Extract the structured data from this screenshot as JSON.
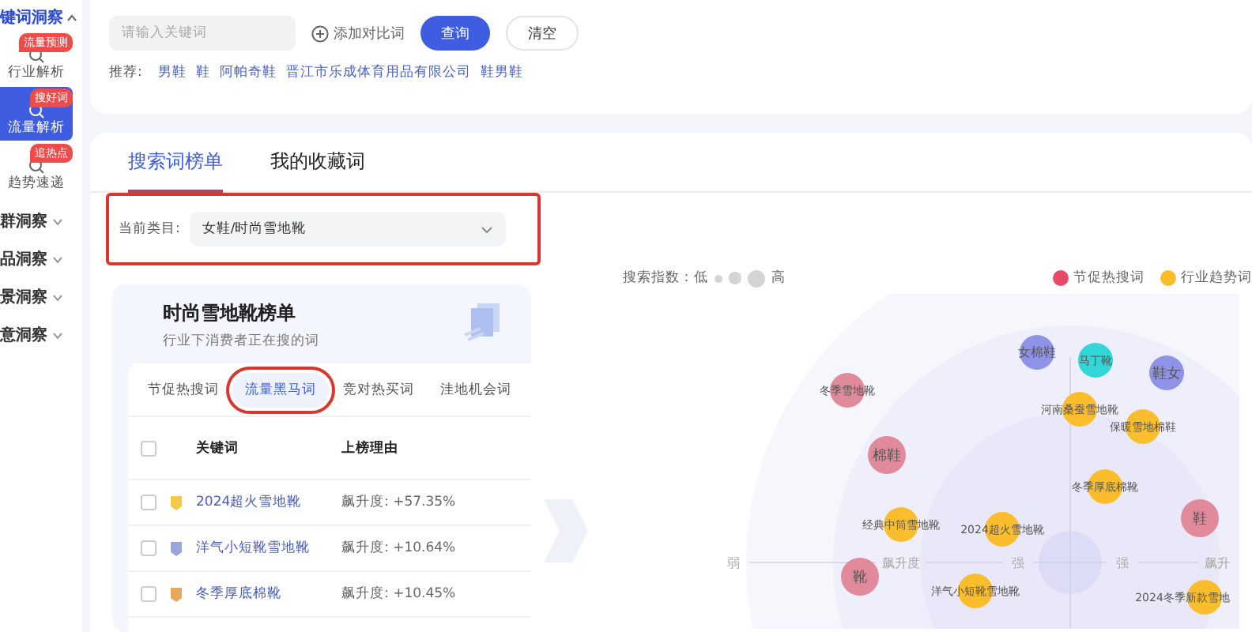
{
  "sidebar": {
    "group_title": "键词洞察",
    "items": [
      {
        "label": "行业解析",
        "badge": "流量预测",
        "selected": false
      },
      {
        "label": "流量解析",
        "badge": "搜好词",
        "selected": true
      },
      {
        "label": "趋势速递",
        "badge": "追热点",
        "selected": false
      }
    ],
    "groups": [
      {
        "label": "群洞察",
        "expanded": false
      },
      {
        "label": "品洞察",
        "expanded": false
      },
      {
        "label": "景洞察",
        "expanded": false
      },
      {
        "label": "意洞察",
        "expanded": false
      }
    ]
  },
  "search": {
    "placeholder": "请输入关键词",
    "add_compare": "添加对比词",
    "query_button": "查询",
    "clear_button": "清空",
    "recommend_label": "推荐:",
    "recommendations": [
      "男鞋",
      "鞋",
      "阿帕奇鞋",
      "晋江市乐成体育用品有限公司",
      "鞋男鞋"
    ]
  },
  "tabs": [
    {
      "label": "搜索词榜单",
      "selected": true
    },
    {
      "label": "我的收藏词",
      "selected": false
    }
  ],
  "category": {
    "label": "当前类目:",
    "value": "女鞋/时尚雪地靴",
    "highlighted": true
  },
  "ranking": {
    "title": "时尚雪地靴榜单",
    "subtitle": "行业下消费者正在搜的词",
    "subtabs": [
      {
        "label": "节促热搜词",
        "selected": false,
        "highlighted": false
      },
      {
        "label": "流量黑马词",
        "selected": true,
        "highlighted": true
      },
      {
        "label": "竞对热买词",
        "selected": false,
        "highlighted": false
      },
      {
        "label": "洼地机会词",
        "selected": false,
        "highlighted": false
      }
    ],
    "columns": [
      "关键词",
      "上榜理由"
    ],
    "header_checked": false,
    "rows": [
      {
        "checked": false,
        "color": "#f2c94c",
        "keyword": "2024超火雪地靴",
        "reason": "飙升度: +57.35%"
      },
      {
        "checked": false,
        "color": "#9aa6d8",
        "keyword": "洋气小短靴雪地靴",
        "reason": "飙升度: +10.64%"
      },
      {
        "checked": false,
        "color": "#e6a85c",
        "keyword": "冬季厚底棉靴",
        "reason": "飙升度: +10.45%"
      }
    ]
  },
  "chart": {
    "index_label": "搜索指数：低",
    "index_high": "高",
    "legend": [
      {
        "label": "节促热搜词",
        "color": "#e84a6a"
      },
      {
        "label": "行业趋势词",
        "color": "#fbbd2c"
      }
    ],
    "axis_labels": [
      "弱",
      "飙升度",
      "强",
      "强",
      "飙升"
    ],
    "bubbles": [
      {
        "label": "女棉鞋",
        "color": "#8f93e8"
      },
      {
        "label": "马丁靴",
        "color": "#33d6d6"
      },
      {
        "label": "鞋女",
        "color": "#8f93e8"
      },
      {
        "label": "冬季雪地靴",
        "color": "#e08a9c"
      },
      {
        "label": "河南桑蚕雪地靴",
        "color": "#fbbd2c"
      },
      {
        "label": "保暖雪地棉鞋",
        "color": "#fbbd2c"
      },
      {
        "label": "棉鞋",
        "color": "#e08a9c"
      },
      {
        "label": "冬季厚底棉靴",
        "color": "#fbbd2c"
      },
      {
        "label": "鞋",
        "color": "#e08a9c"
      },
      {
        "label": "经典中筒雪地靴",
        "color": "#fbbd2c"
      },
      {
        "label": "2024超火雪地靴",
        "color": "#fbbd2c"
      },
      {
        "label": "靴",
        "color": "#e08a9c"
      },
      {
        "label": "洋气小短靴雪地靴",
        "color": "#fbbd2c"
      },
      {
        "label": "2024冬季新款雪地",
        "color": "#fbbd2c"
      }
    ]
  }
}
